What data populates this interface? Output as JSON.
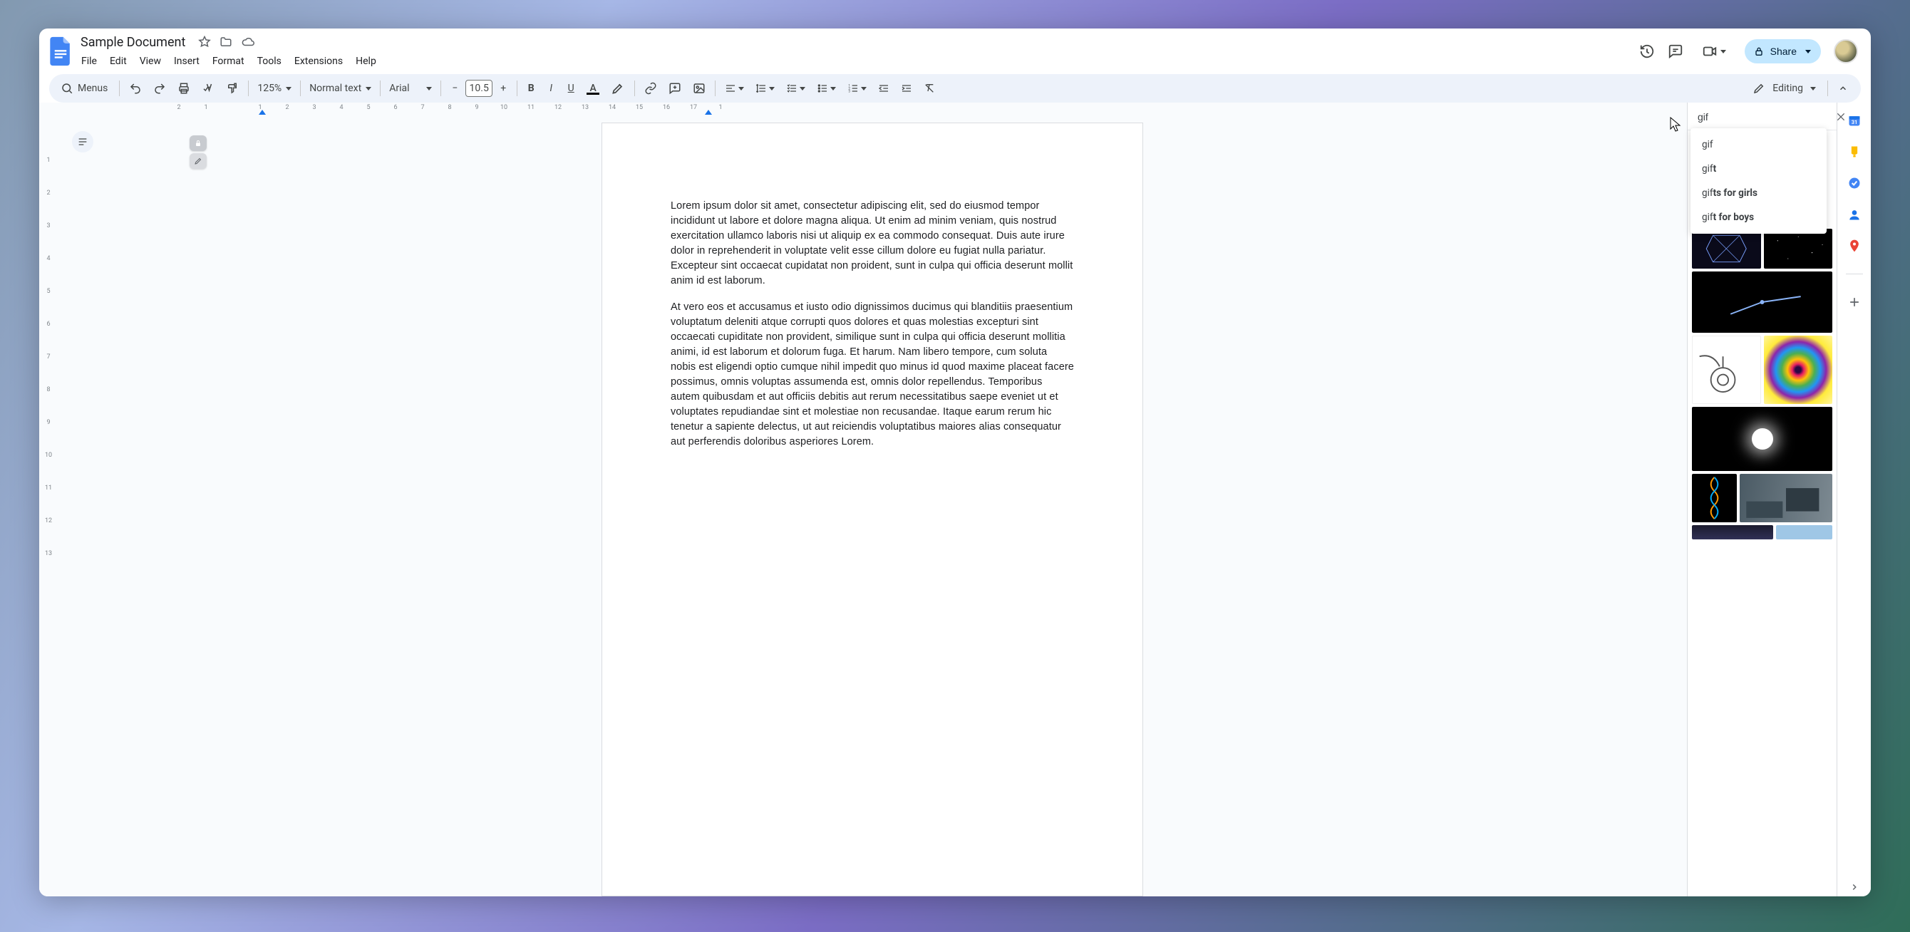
{
  "doc": {
    "title": "Sample Document",
    "menus": [
      "File",
      "Edit",
      "View",
      "Insert",
      "Format",
      "Tools",
      "Extensions",
      "Help"
    ]
  },
  "header": {
    "share_label": "Share"
  },
  "toolbar": {
    "menus_label": "Menus",
    "zoom": "125%",
    "style": "Normal text",
    "font": "Arial",
    "font_size": "10.5",
    "mode": "Editing"
  },
  "ruler": {
    "top_marks": [
      "2",
      "1",
      "",
      "1",
      "2",
      "3",
      "4",
      "5",
      "6",
      "7",
      "8",
      "9",
      "10",
      "11",
      "12",
      "13",
      "14",
      "15",
      "16",
      "17",
      "1"
    ],
    "left_marks": [
      "",
      "1",
      "2",
      "3",
      "4",
      "5",
      "6",
      "7",
      "8",
      "9",
      "10",
      "11",
      "12",
      "13"
    ]
  },
  "body": {
    "para1": "Lorem ipsum dolor sit amet, consectetur adipiscing elit, sed do eiusmod tempor incididunt ut labore et dolore magna aliqua. Ut enim ad minim veniam, quis nostrud exercitation ullamco laboris nisi ut aliquip ex ea commodo consequat. Duis aute irure dolor in reprehenderit in voluptate velit esse cillum dolore eu fugiat nulla pariatur. Excepteur sint occaecat cupidatat non proident, sunt in culpa qui officia deserunt mollit anim id est laborum.",
    "para2": "At vero eos et accusamus et iusto odio dignissimos ducimus qui blanditiis praesentium voluptatum deleniti atque corrupti quos dolores et quas molestias excepturi sint occaecati cupiditate non provident, similique sunt in culpa qui officia deserunt mollitia animi, id est laborum et dolorum fuga. Et harum. Nam libero tempore, cum soluta nobis est eligendi optio cumque nihil impedit quo minus id quod maxime placeat facere possimus, omnis voluptas assumenda est, omnis dolor repellendus. Temporibus autem quibusdam et aut officiis debitis aut rerum necessitatibus saepe eveniet ut et voluptates repudiandae sint et molestiae non recusandae. Itaque earum rerum hic tenetur a sapiente delectus, ut aut reiciendis voluptatibus maiores alias consequatur aut perferendis doloribus asperiores Lorem."
  },
  "explore": {
    "query": "gif",
    "suggestions": [
      {
        "typed": "gif",
        "rest": ""
      },
      {
        "typed": "gif",
        "rest": "t"
      },
      {
        "typed": "gif",
        "rest": "ts for girls"
      },
      {
        "typed": "gif",
        "rest": "t for boys"
      }
    ]
  }
}
